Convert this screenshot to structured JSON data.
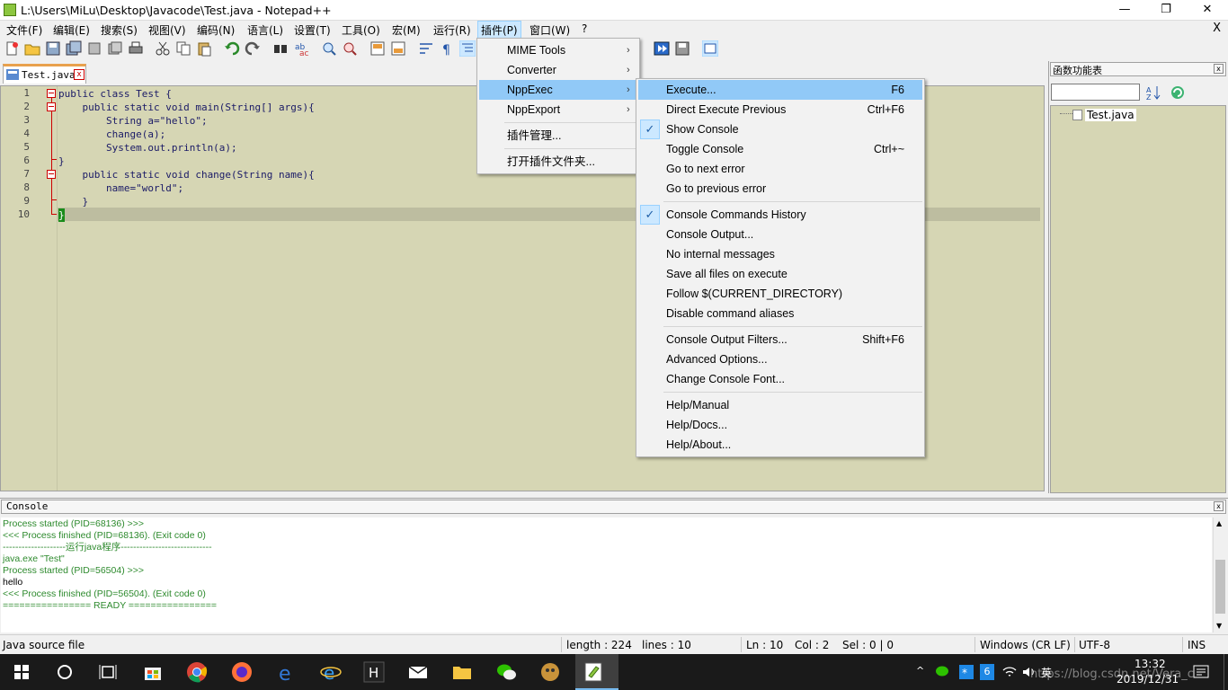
{
  "window": {
    "title": "L:\\Users\\MiLu\\Desktop\\Javacode\\Test.java - Notepad++",
    "minimize": "—",
    "restore": "❐",
    "close": "✕"
  },
  "menubar": {
    "items": [
      "文件(F)",
      "编辑(E)",
      "搜索(S)",
      "视图(V)",
      "编码(N)",
      "语言(L)",
      "设置(T)",
      "工具(O)",
      "宏(M)",
      "运行(R)",
      "插件(P)",
      "窗口(W)",
      "?"
    ],
    "doc_close": "X"
  },
  "tabs": [
    {
      "label": "Test.java",
      "close": "x"
    }
  ],
  "editor": {
    "line_numbers": [
      "1",
      "2",
      "3",
      "4",
      "5",
      "6",
      "7",
      "8",
      "9",
      "10"
    ],
    "lines": [
      "public class Test {",
      "    public static void main(String[] args){",
      "        String a=\"hello\";",
      "        change(a);",
      "        System.out.println(a);",
      "}",
      "    public static void change(String name){",
      "        name=\"world\";",
      "    }",
      "}"
    ]
  },
  "function_panel": {
    "title": "函数功能表",
    "close": "x",
    "tree_item": "Test.java"
  },
  "plugins_menu": {
    "items": [
      {
        "label": "MIME Tools",
        "submenu": true
      },
      {
        "label": "Converter",
        "submenu": true
      },
      {
        "label": "NppExec",
        "submenu": true,
        "selected": true
      },
      {
        "label": "NppExport",
        "submenu": true
      },
      {
        "label": "插件管理...",
        "submenu": false
      },
      {
        "label": "打开插件文件夹...",
        "submenu": false
      }
    ],
    "arrow": "›"
  },
  "nppexec_menu": {
    "items": [
      {
        "label": "Execute...",
        "shortcut": "F6",
        "selected": true
      },
      {
        "label": "Direct Execute Previous",
        "shortcut": "Ctrl+F6"
      },
      {
        "label": "Show Console",
        "checked": true
      },
      {
        "label": "Toggle Console",
        "shortcut": "Ctrl+~"
      },
      {
        "label": "Go to next error"
      },
      {
        "label": "Go to previous error"
      },
      {
        "label": "Console Commands History",
        "checked": true
      },
      {
        "label": "Console Output..."
      },
      {
        "label": "No internal messages"
      },
      {
        "label": "Save all files on execute"
      },
      {
        "label": "Follow $(CURRENT_DIRECTORY)"
      },
      {
        "label": "Disable command aliases"
      },
      {
        "label": "Console Output Filters...",
        "shortcut": "Shift+F6"
      },
      {
        "label": "Advanced Options..."
      },
      {
        "label": "Change Console Font..."
      },
      {
        "label": "Help/Manual"
      },
      {
        "label": "Help/Docs..."
      },
      {
        "label": "Help/About..."
      }
    ],
    "check": "✓"
  },
  "console": {
    "title": "Console",
    "close": "x",
    "lines": [
      {
        "text": "Process started (PID=68136) >>>",
        "color": "green"
      },
      {
        "text": "<<< Process finished (PID=68136). (Exit code 0)",
        "color": "green"
      },
      {
        "text": "--------------------运行java程序-----------------------------",
        "color": "green"
      },
      {
        "text": "java.exe \"Test\"",
        "color": "green"
      },
      {
        "text": "Process started (PID=56504) >>>",
        "color": "green"
      },
      {
        "text": "hello",
        "color": "black"
      },
      {
        "text": "<<< Process finished (PID=56504). (Exit code 0)",
        "color": "green"
      },
      {
        "text": "================ READY ================",
        "color": "green"
      }
    ]
  },
  "statusbar": {
    "file_type": "Java source file",
    "length": "length : 224",
    "lines": "lines : 10",
    "ln": "Ln : 10",
    "col": "Col : 2",
    "sel": "Sel : 0 | 0",
    "eol": "Windows (CR LF)",
    "encoding": "UTF-8",
    "mode": "INS"
  },
  "taskbar": {
    "ime": "英",
    "time": "13:32",
    "date": "2019/12/31",
    "watermark": "https://blog.csdn.net/Vera_c",
    "badge": "6"
  },
  "colors": {
    "editor_bg": "#d6d6b4",
    "menu_highlight": "#91c9f7",
    "console_green": "#2d8a2d",
    "taskbar": "#1a1a1a"
  }
}
